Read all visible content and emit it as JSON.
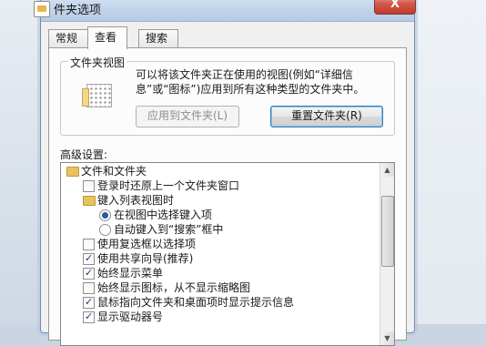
{
  "window": {
    "title": "件夹选项",
    "close_label": "X"
  },
  "tabs": [
    {
      "label": "常规"
    },
    {
      "label": "查看"
    },
    {
      "label": "搜索"
    }
  ],
  "folder_views": {
    "group_label": "文件夹视图",
    "description": "可以将该文件夹正在使用的视图(例如“详细信息”或“图标”)应用到所有这种类型的文件夹中。",
    "apply_button": "应用到文件夹(L)",
    "reset_button": "重置文件夹(R)"
  },
  "advanced": {
    "label": "高级设置:",
    "items": [
      {
        "type": "folder",
        "label": "文件和文件夹"
      },
      {
        "type": "checkbox",
        "checked": false,
        "label": "登录时还原上一个文件夹窗口"
      },
      {
        "type": "folder",
        "label": "键入列表视图时"
      },
      {
        "type": "radio",
        "checked": true,
        "label": "在视图中选择键入项"
      },
      {
        "type": "radio",
        "checked": false,
        "label": "自动键入到“搜索”框中"
      },
      {
        "type": "checkbox",
        "checked": false,
        "label": "使用复选框以选择项"
      },
      {
        "type": "checkbox",
        "checked": true,
        "label": "使用共享向导(推荐)"
      },
      {
        "type": "checkbox",
        "checked": true,
        "label": "始终显示菜单"
      },
      {
        "type": "checkbox",
        "checked": false,
        "label": "始终显示图标，从不显示缩略图"
      },
      {
        "type": "checkbox",
        "checked": true,
        "label": "鼠标指向文件夹和桌面项时显示提示信息"
      },
      {
        "type": "checkbox",
        "checked": true,
        "label": "显示驱动器号"
      }
    ]
  }
}
